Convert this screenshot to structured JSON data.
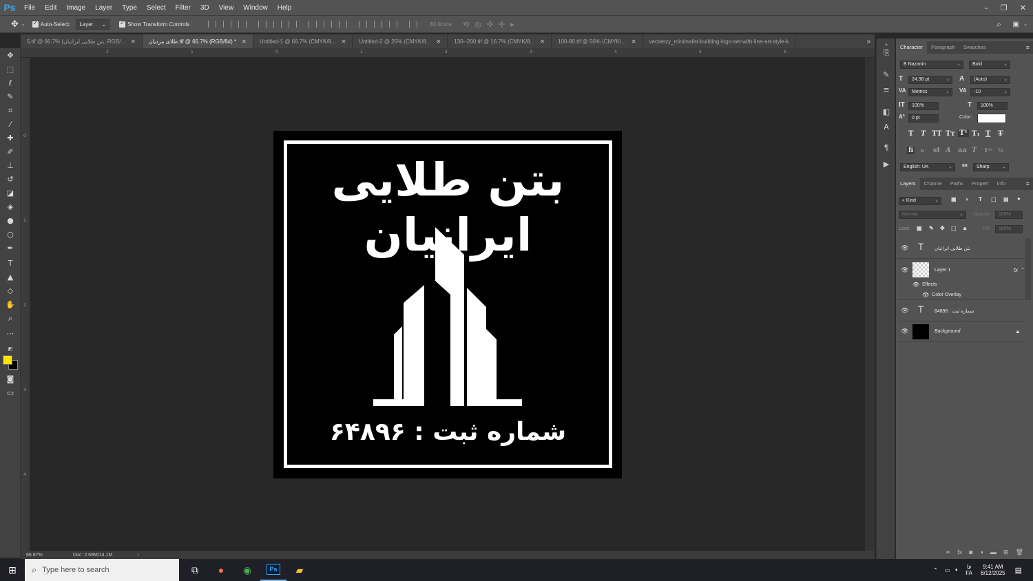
{
  "app": {
    "logo": "Ps"
  },
  "menu": [
    "File",
    "Edit",
    "Image",
    "Layer",
    "Type",
    "Select",
    "Filter",
    "3D",
    "View",
    "Window",
    "Help"
  ],
  "window_controls": {
    "minimize": "–",
    "restore": "❐",
    "close": "✕"
  },
  "options_bar": {
    "auto_select_label": "Auto-Select:",
    "auto_select_value": "Layer",
    "show_transform_label": "Show Transform Controls",
    "mode_3d_label": "3D Mode:"
  },
  "tabs": [
    {
      "label": "5.tif @ 66.7% (بتن طلایی ایرانیان, RGB/...",
      "active": false
    },
    {
      "label": "طلای مردیان.tif @ 66.7% (RGB/8#) *",
      "active": true
    },
    {
      "label": "Untitled-1 @ 66.7% (CMYK/8...",
      "active": false
    },
    {
      "label": "Untitled-2 @ 25% (CMYK/8...",
      "active": false
    },
    {
      "label": "130--200.tif @ 16.7% (CMYK/8...",
      "active": false
    },
    {
      "label": "100-80.tif @ 50% (CMYK/...",
      "active": false
    },
    {
      "label": "vecteezy_minimalist-building-logo-set-with-line-art-style-k",
      "active": false
    }
  ],
  "ruler_top": [
    "2",
    "1",
    "0",
    "1",
    "2",
    "3",
    "4",
    "5",
    "6"
  ],
  "ruler_left": [
    "0",
    "1",
    "2",
    "3",
    "4"
  ],
  "document": {
    "title_text": "بتن طلایی ایرانیان",
    "registration_text": "شماره ثبت : ۶۴۸۹۶",
    "colors": {
      "background": "#000000",
      "foreground": "#ffffff"
    }
  },
  "status": {
    "zoom": "66.67%",
    "doc_size": "Doc: 2.69M/14.1M"
  },
  "character_panel": {
    "tabs": [
      "Character",
      "Paragraph",
      "Swatches"
    ],
    "font_family": "B Nazanin",
    "font_style": "Bold",
    "font_size": "24.96 pt",
    "leading": "(Auto)",
    "kerning": "Metrics",
    "tracking": "-10",
    "vertical_scale": "100%",
    "horizontal_scale": "100%",
    "baseline_shift": "0 pt",
    "color_label": "Color:",
    "color_value": "#ffffff",
    "language": "English: UK",
    "anti_alias_label": "aa",
    "anti_alias": "Sharp"
  },
  "layers_panel": {
    "tabs": [
      "Layers",
      "Channe",
      "Paths",
      "Propert",
      "Info"
    ],
    "filter_kind": "Kind",
    "blend_mode": "Normal",
    "opacity_label": "Opacity:",
    "opacity_value": "100%",
    "lock_label": "Lock:",
    "fill_label": "Fill:",
    "fill_value": "100%",
    "layers": [
      {
        "name": "بتن طلایی ایرانیان",
        "type": "text"
      },
      {
        "name": "Layer 1",
        "type": "image",
        "fx": "fx"
      },
      {
        "name": "Effects",
        "type": "effects"
      },
      {
        "name": "Color Overlay",
        "type": "effect"
      },
      {
        "name": "شماره ثبت : 64896",
        "type": "text"
      },
      {
        "name": "Background",
        "type": "background"
      }
    ]
  },
  "taskbar": {
    "search_placeholder": "Type here to search",
    "time": "9:41 AM",
    "date": "8/12/2025",
    "language": "FA",
    "language_top": "فا"
  },
  "swatch_colors": {
    "foreground": "#ffe600",
    "background": "#000000"
  }
}
